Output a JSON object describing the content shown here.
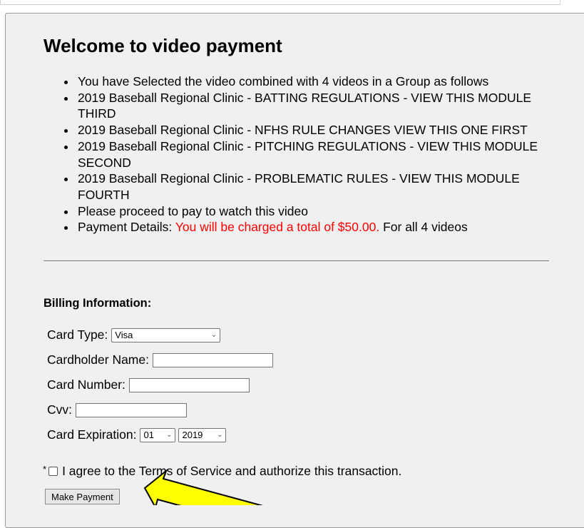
{
  "page": {
    "title": "Welcome to video payment",
    "items": [
      "You have Selected the video combined with 4 videos in a Group as follows",
      "2019 Baseball Regional Clinic - BATTING REGULATIONS - VIEW THIS MODULE THIRD",
      "2019 Baseball Regional Clinic - NFHS RULE CHANGES VIEW THIS ONE FIRST",
      "2019 Baseball Regional Clinic - PITCHING REGULATIONS - VIEW THIS MODULE SECOND",
      "2019 Baseball Regional Clinic - PROBLEMATIC RULES - VIEW THIS MODULE FOURTH",
      "Please proceed to pay to watch this video"
    ],
    "payment_details_label": "Payment Details:",
    "payment_charge": "You will be charged a total of $50.00.",
    "payment_suffix": "For all 4 videos"
  },
  "billing": {
    "title": "Billing Information:",
    "card_type_label": "Card Type:",
    "card_type_value": "Visa",
    "cardholder_label": "Cardholder Name:",
    "card_number_label": "Card Number:",
    "cvv_label": "Cvv:",
    "expiration_label": "Card Expiration:",
    "exp_month": "01",
    "exp_year": "2019",
    "required_marker": "*",
    "agree_text": "I agree to the Terms of Service and authorize this transaction.",
    "pay_button": "Make Payment"
  },
  "annotation": {
    "arrow_color": "#ffff00"
  }
}
